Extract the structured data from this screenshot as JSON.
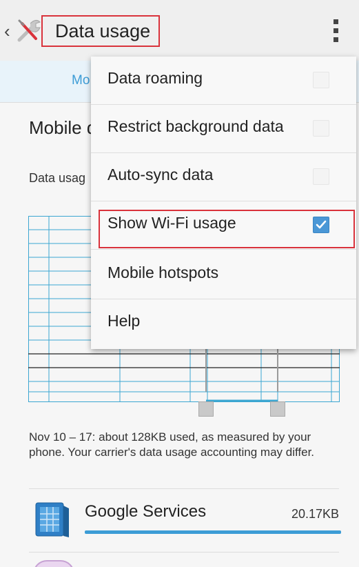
{
  "actionbar": {
    "title": "Data usage",
    "back_glyph": "‹",
    "app_icon": "settings-wrench-icon",
    "overflow_icon": "more-vert-icon"
  },
  "tabs": {
    "partial_label": "Mo"
  },
  "content": {
    "section_label_partial": "Mobile d",
    "cycle_label_partial": "Data usag",
    "summary": "Nov 10 – 17: about 128KB used, as measured by your phone. Your carrier's data usage accounting may differ."
  },
  "apps": [
    {
      "name": "Google Services",
      "size": "20.17KB",
      "icon": "google-services-icon"
    }
  ],
  "menu": {
    "items": [
      {
        "label": "Data roaming",
        "checkbox": true,
        "checked": false
      },
      {
        "label": "Restrict background data",
        "checkbox": true,
        "checked": false
      },
      {
        "label": "Auto-sync data",
        "checkbox": true,
        "checked": false
      },
      {
        "label": "Show Wi-Fi usage",
        "checkbox": true,
        "checked": true
      },
      {
        "label": "Mobile hotspots",
        "checkbox": false
      },
      {
        "label": "Help",
        "checkbox": false
      }
    ]
  },
  "colors": {
    "accent": "#3c9cd6",
    "highlight_box": "#d9323b",
    "checkbox_on": "#4a97d6"
  }
}
